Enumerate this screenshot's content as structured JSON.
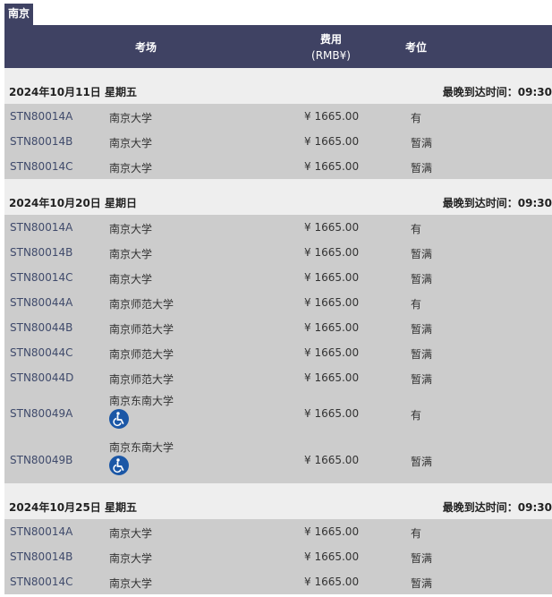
{
  "city": "南京",
  "header": {
    "venue": "考场",
    "fee_line1": "费用",
    "fee_line2": "(RMB¥)",
    "seat": "考位"
  },
  "sections": [
    {
      "date": "2024年10月11日 星期五",
      "latest": "最晚到达时间：09:30",
      "rows": [
        {
          "code": "STN80014A",
          "venue": "南京大学",
          "fee": "¥ 1665.00",
          "seat": "有"
        },
        {
          "code": "STN80014B",
          "venue": "南京大学",
          "fee": "¥ 1665.00",
          "seat": "暂满"
        },
        {
          "code": "STN80014C",
          "venue": "南京大学",
          "fee": "¥ 1665.00",
          "seat": "暂满"
        }
      ]
    },
    {
      "date": "2024年10月20日 星期日",
      "latest": "最晚到达时间：09:30",
      "rows": [
        {
          "code": "STN80014A",
          "venue": "南京大学",
          "fee": "¥ 1665.00",
          "seat": "有"
        },
        {
          "code": "STN80014B",
          "venue": "南京大学",
          "fee": "¥ 1665.00",
          "seat": "暂满"
        },
        {
          "code": "STN80014C",
          "venue": "南京大学",
          "fee": "¥ 1665.00",
          "seat": "暂满"
        },
        {
          "code": "STN80044A",
          "venue": "南京师范大学",
          "fee": "¥ 1665.00",
          "seat": "有"
        },
        {
          "code": "STN80044B",
          "venue": "南京师范大学",
          "fee": "¥ 1665.00",
          "seat": "暂满"
        },
        {
          "code": "STN80044C",
          "venue": "南京师范大学",
          "fee": "¥ 1665.00",
          "seat": "暂满"
        },
        {
          "code": "STN80044D",
          "venue": "南京师范大学",
          "fee": "¥ 1665.00",
          "seat": "暂满"
        },
        {
          "code": "STN80049A",
          "venue": "南京东南大学",
          "fee": "¥ 1665.00",
          "seat": "有",
          "accessible": true
        },
        {
          "code": "STN80049B",
          "venue": "南京东南大学",
          "fee": "¥ 1665.00",
          "seat": "暂满",
          "accessible": true
        }
      ]
    },
    {
      "date": "2024年10月25日 星期五",
      "latest": "最晚到达时间：09:30",
      "rows": [
        {
          "code": "STN80014A",
          "venue": "南京大学",
          "fee": "¥ 1665.00",
          "seat": "有"
        },
        {
          "code": "STN80014B",
          "venue": "南京大学",
          "fee": "¥ 1665.00",
          "seat": "暂满"
        },
        {
          "code": "STN80014C",
          "venue": "南京大学",
          "fee": "¥ 1665.00",
          "seat": "暂满"
        }
      ]
    }
  ],
  "icons": {
    "accessible": "wheelchair-icon"
  },
  "colors": {
    "header_bg": "#3f4263",
    "date_row_bg": "#eeeeee",
    "data_row_bg": "#cccccc",
    "code_text": "#3f4a6b",
    "wheelchair_bg": "#1b57a6"
  }
}
